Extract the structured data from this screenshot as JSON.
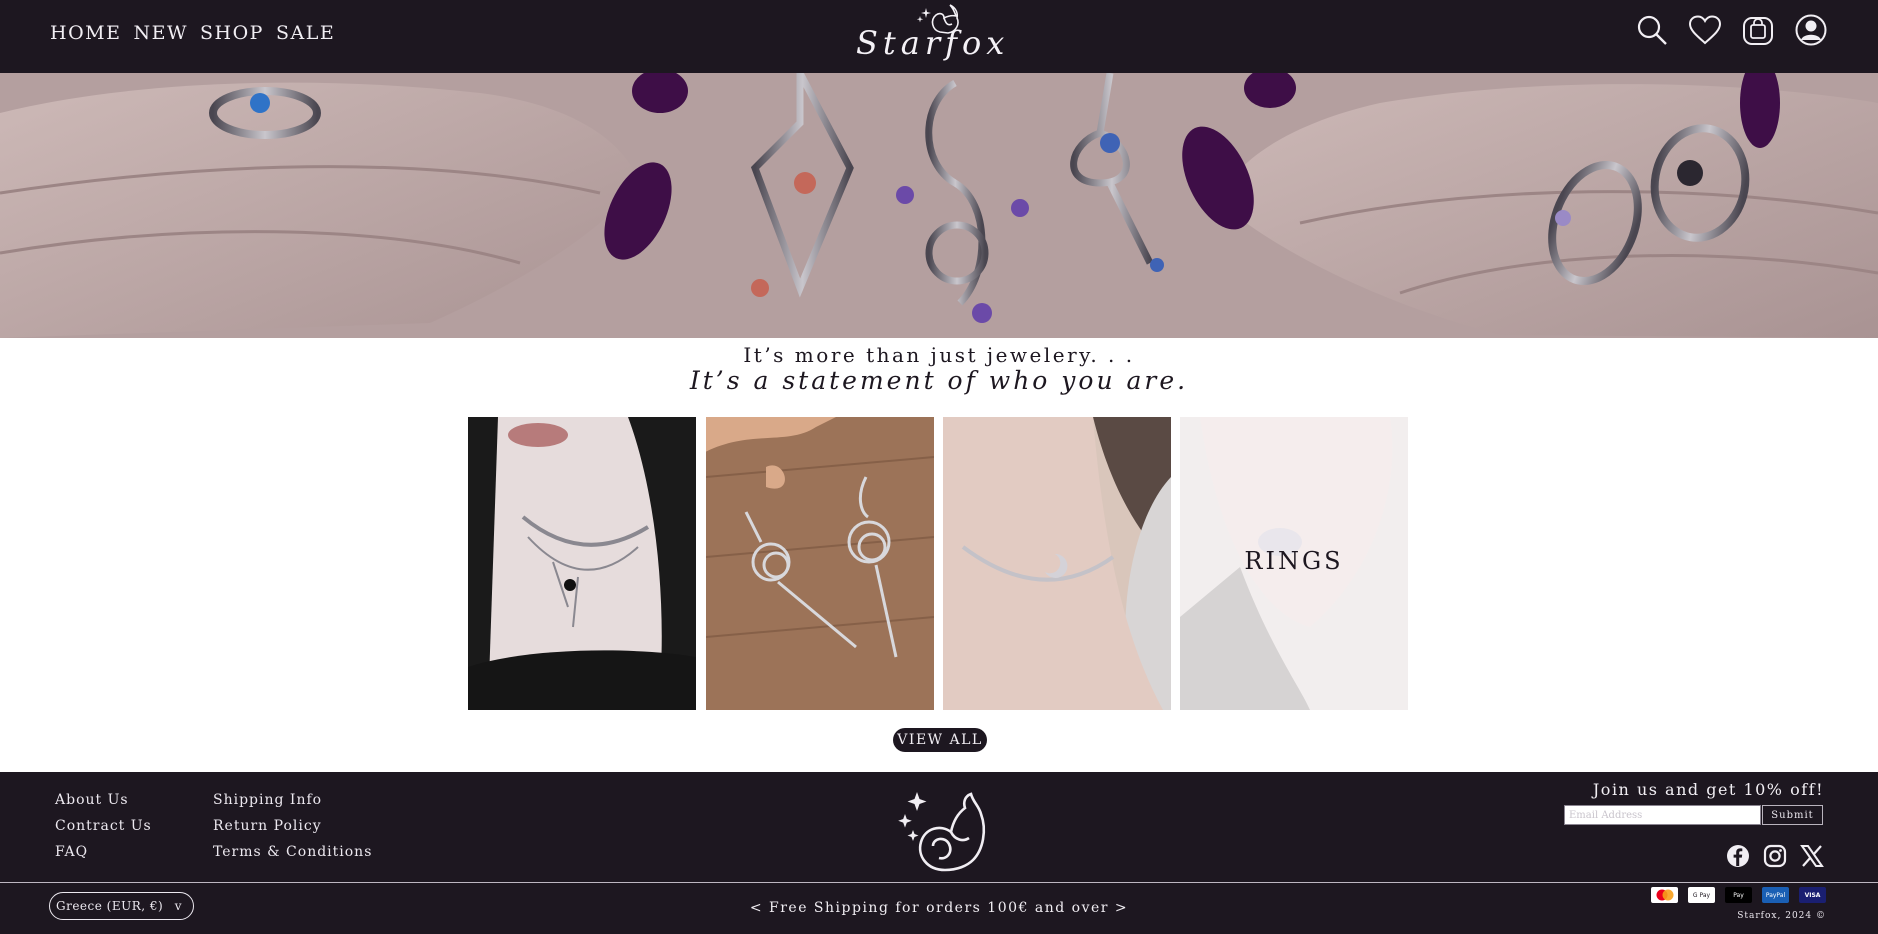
{
  "header": {
    "nav": [
      "HOME",
      "NEW",
      "SHOP",
      "SALE"
    ],
    "logo_text": "Starfox",
    "icons": [
      "search-icon",
      "heart-icon",
      "shopping-bag-icon",
      "account-icon"
    ]
  },
  "hero": {
    "image": "hands-with-rings-and-pendants"
  },
  "tagline": {
    "line1": "It’s more than just jewelery. . .",
    "line2": "It’s a statement of who you are."
  },
  "categories": [
    {
      "image": "necklace-on-model",
      "label": ""
    },
    {
      "image": "earrings-on-wood",
      "label": ""
    },
    {
      "image": "moon-bracelet-on-wrist",
      "label": ""
    },
    {
      "image": "ring-on-finger",
      "label": "RINGS"
    }
  ],
  "view_all_label": "VIEW ALL",
  "footer": {
    "col1": [
      "About Us",
      "Contract Us",
      "FAQ"
    ],
    "col2": [
      "Shipping Info",
      "Return Policy",
      "Terms & Conditions"
    ],
    "newsletter": {
      "title": "Join us and get 10% off!",
      "placeholder": "Email Address",
      "submit": "Submit"
    },
    "socials": [
      "facebook-icon",
      "instagram-icon",
      "x-icon"
    ],
    "country": "Greece (EUR, €)",
    "country_chevron": "v",
    "shipping_text": "< Free Shipping for orders 100€ and over >",
    "payments": [
      "mastercard-icon",
      "google-pay-icon",
      "apple-pay-icon",
      "paypal-icon",
      "visa-icon"
    ],
    "payment_labels": [
      "",
      "G Pay",
      "Pay",
      "PayPal",
      "VISA"
    ],
    "copyright": "Starfox, 2024 ©"
  },
  "colors": {
    "dark": "#1d1720",
    "light_text": "#f1eef3",
    "nail_purple": "#3e0e47"
  }
}
